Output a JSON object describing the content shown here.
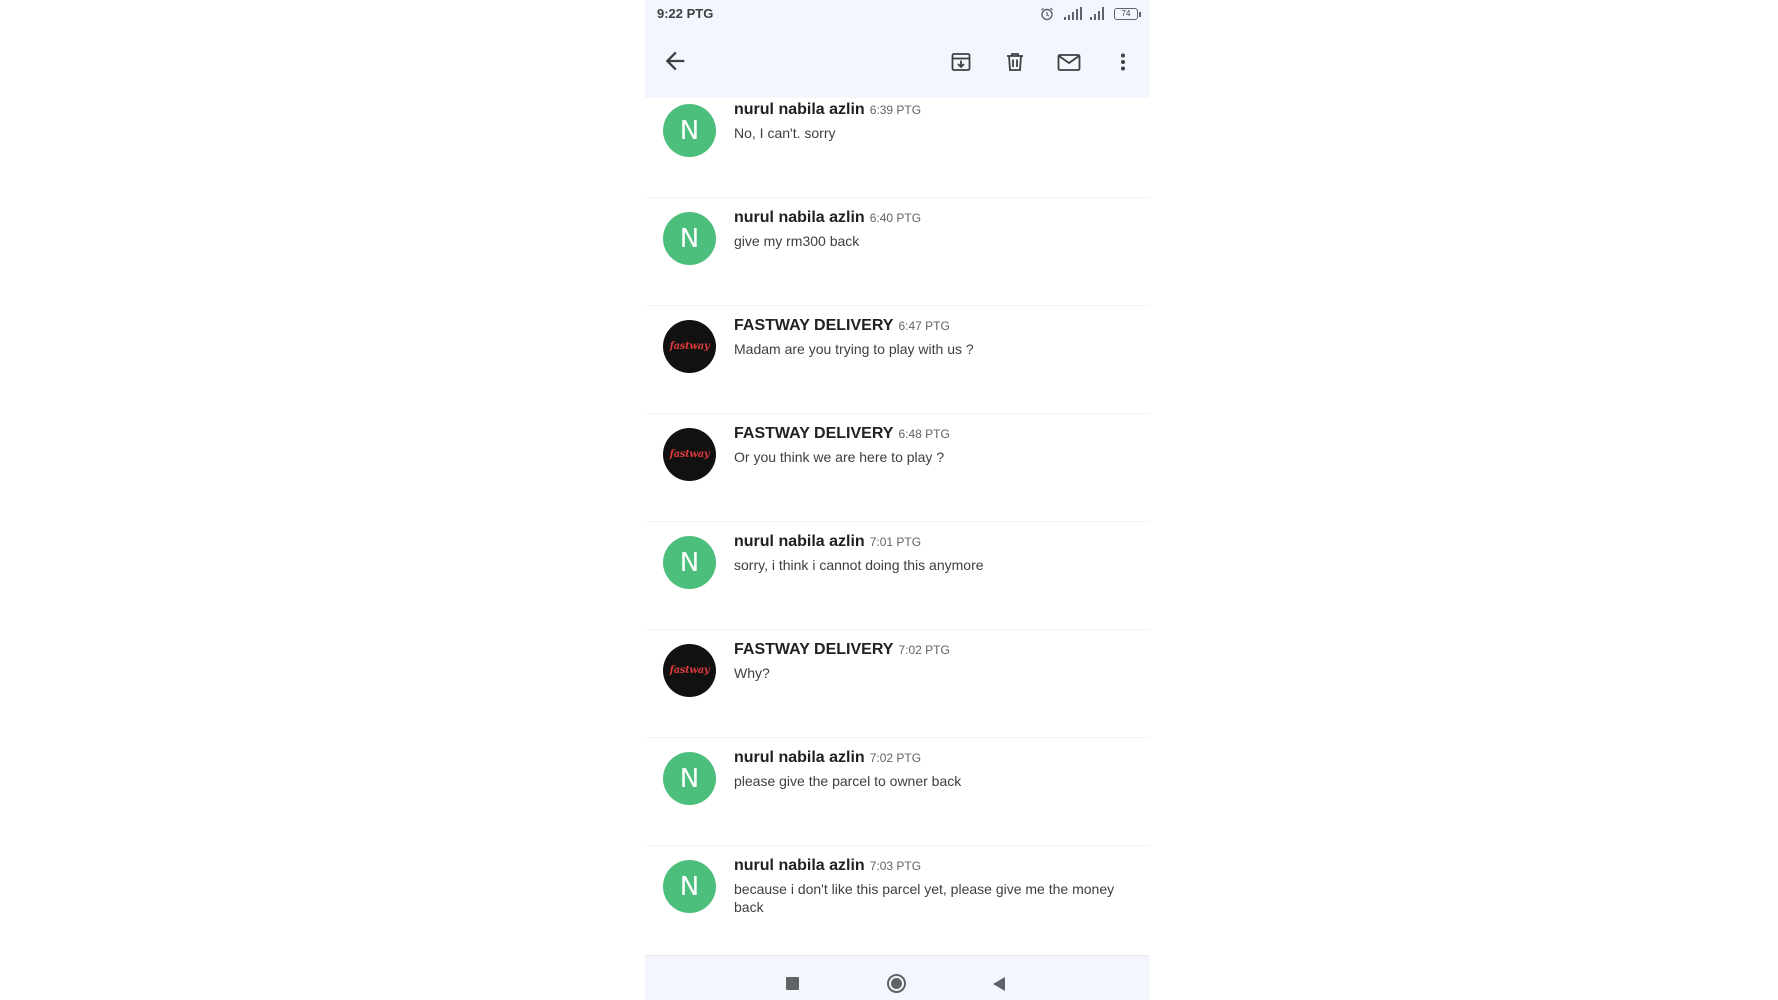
{
  "status_bar": {
    "time": "9:22 PTG",
    "battery": "74"
  },
  "toolbar": {
    "back_icon": "arrow-left-icon",
    "archive_icon": "archive-icon",
    "delete_icon": "trash-icon",
    "mark_unread_icon": "mail-icon",
    "more_icon": "more-vert-icon"
  },
  "colors": {
    "avatar_green": "#4cbf7c",
    "avatar_black": "#111111",
    "bar_tint": "#f3f6fc"
  },
  "messages": [
    {
      "sender": "nurul nabila azlin",
      "time": "6:39 PTG",
      "text": "No, I can't. sorry",
      "avatar": "N"
    },
    {
      "sender": "nurul nabila azlin",
      "time": "6:40 PTG",
      "text": "give my rm300 back",
      "avatar": "N"
    },
    {
      "sender": "FASTWAY DELIVERY",
      "time": "6:47 PTG",
      "text": "Madam are you trying to play with us ?",
      "avatar_logo": "fastway"
    },
    {
      "sender": "FASTWAY DELIVERY",
      "time": "6:48 PTG",
      "text": "Or you think we are here to play ?",
      "avatar_logo": "fastway"
    },
    {
      "sender": "nurul nabila azlin",
      "time": "7:01 PTG",
      "text": "sorry, i think i cannot doing this anymore",
      "avatar": "N"
    },
    {
      "sender": "FASTWAY DELIVERY",
      "time": "7:02 PTG",
      "text": "Why?",
      "avatar_logo": "fastway"
    },
    {
      "sender": "nurul nabila azlin",
      "time": "7:02 PTG",
      "text": "please give the parcel to owner back",
      "avatar": "N"
    },
    {
      "sender": "nurul nabila azlin",
      "time": "7:03 PTG",
      "text": "because i don't like this parcel yet, please give me the money back",
      "avatar": "N"
    }
  ],
  "nav_bar": {
    "recents_icon": "square-icon",
    "home_icon": "circle-icon",
    "back_icon": "triangle-back-icon"
  }
}
